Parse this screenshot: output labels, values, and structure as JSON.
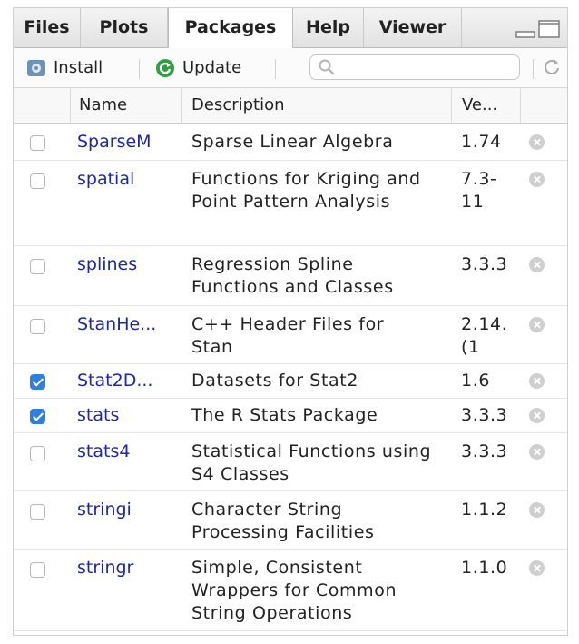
{
  "tabs": [
    {
      "label": "Files"
    },
    {
      "label": "Plots"
    },
    {
      "label": "Packages",
      "active": true
    },
    {
      "label": "Help"
    },
    {
      "label": "Viewer"
    }
  ],
  "toolbar": {
    "install_label": "Install",
    "update_label": "Update",
    "search_placeholder": ""
  },
  "table": {
    "columns": [
      "Name",
      "Description",
      "Ve..."
    ],
    "rows": [
      {
        "checked": false,
        "name": "SparseM",
        "description": "Sparse Linear Algebra",
        "version": "1.74"
      },
      {
        "checked": false,
        "name": "spatial",
        "description": "Functions for Kriging and Point Pattern Analysis",
        "version": "7.3-11"
      },
      {
        "checked": false,
        "name": "splines",
        "description": "Regression Spline Functions and Classes",
        "version": "3.3.3"
      },
      {
        "checked": false,
        "name": "StanHe...",
        "description": "C++ Header Files for Stan",
        "version": "2.14.(1"
      },
      {
        "checked": true,
        "name": "Stat2D...",
        "description": "Datasets for Stat2",
        "version": "1.6"
      },
      {
        "checked": true,
        "name": "stats",
        "description": "The R Stats Package",
        "version": "3.3.3"
      },
      {
        "checked": false,
        "name": "stats4",
        "description": "Statistical Functions using S4 Classes",
        "version": "3.3.3"
      },
      {
        "checked": false,
        "name": "stringi",
        "description": "Character String Processing Facilities",
        "version": "1.1.2"
      },
      {
        "checked": false,
        "name": "stringr",
        "description": "Simple, Consistent Wrappers for Common String Operations",
        "version": "1.1.0"
      }
    ]
  },
  "colors": {
    "package_link": "#1b27a8",
    "checkbox_checked": "#2f7fe0",
    "update_icon": "#2ea043"
  },
  "icons": {
    "install": "install-package-icon",
    "update": "refresh-circle-icon",
    "search": "search-icon",
    "refresh": "refresh-icon",
    "remove": "remove-x-icon"
  }
}
